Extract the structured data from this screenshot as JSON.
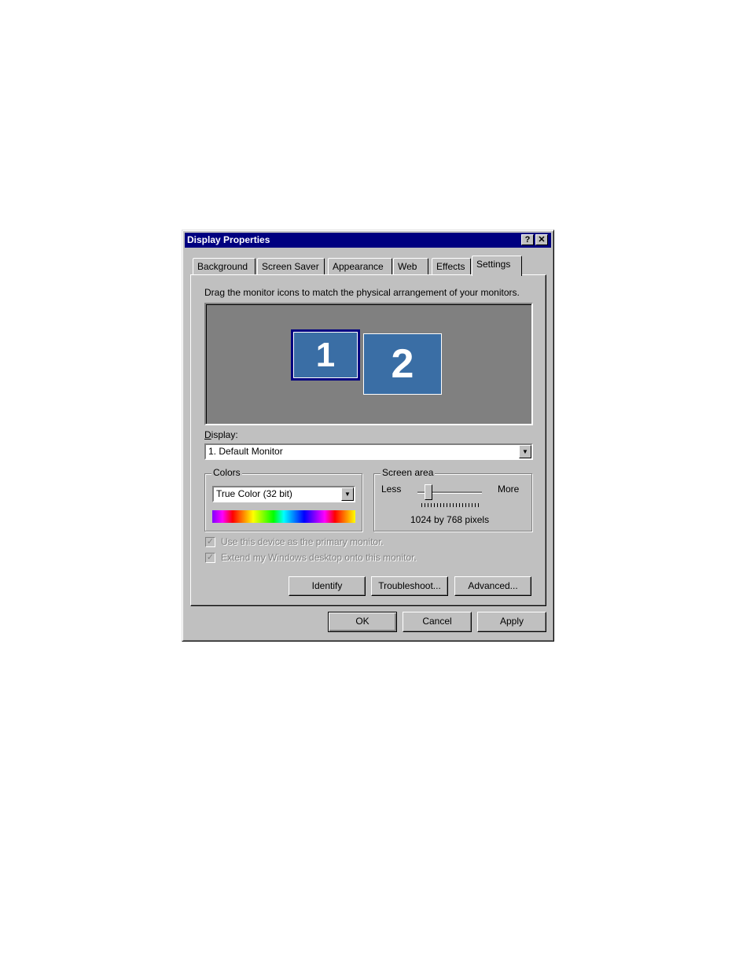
{
  "window": {
    "title": "Display Properties",
    "help_glyph": "?",
    "close_glyph": "✕"
  },
  "tabs": [
    {
      "label": "Background"
    },
    {
      "label": "Screen Saver"
    },
    {
      "label": "Appearance"
    },
    {
      "label": "Web"
    },
    {
      "label": "Effects"
    },
    {
      "label": "Settings",
      "active": true
    }
  ],
  "settings": {
    "instructions": "Drag the monitor icons to match the physical arrangement of your monitors.",
    "monitors": [
      {
        "label": "1"
      },
      {
        "label": "2"
      }
    ],
    "display_label": "Display:",
    "display_value": "1. Default Monitor",
    "colors": {
      "label": "Colors",
      "value": "True Color (32 bit)"
    },
    "screen_area": {
      "label": "Screen area",
      "less": "Less",
      "more": "More",
      "resolution": "1024 by 768 pixels"
    },
    "primary_monitor": "Use this device as the primary monitor.",
    "extend_desktop": "Extend my Windows desktop onto this monitor.",
    "identify_button": "Identify",
    "troubleshoot_button": "Troubleshoot...",
    "advanced_button": "Advanced..."
  },
  "footer": {
    "ok_button": "OK",
    "cancel_button": "Cancel",
    "apply_button": "Apply"
  },
  "check_glyph": "✓",
  "dropdown_glyph": "▼",
  "colors": {
    "titlebar": "#000080",
    "face": "#c0c0c0",
    "desktop": "#808080",
    "monitor": "#3a6ea5"
  }
}
